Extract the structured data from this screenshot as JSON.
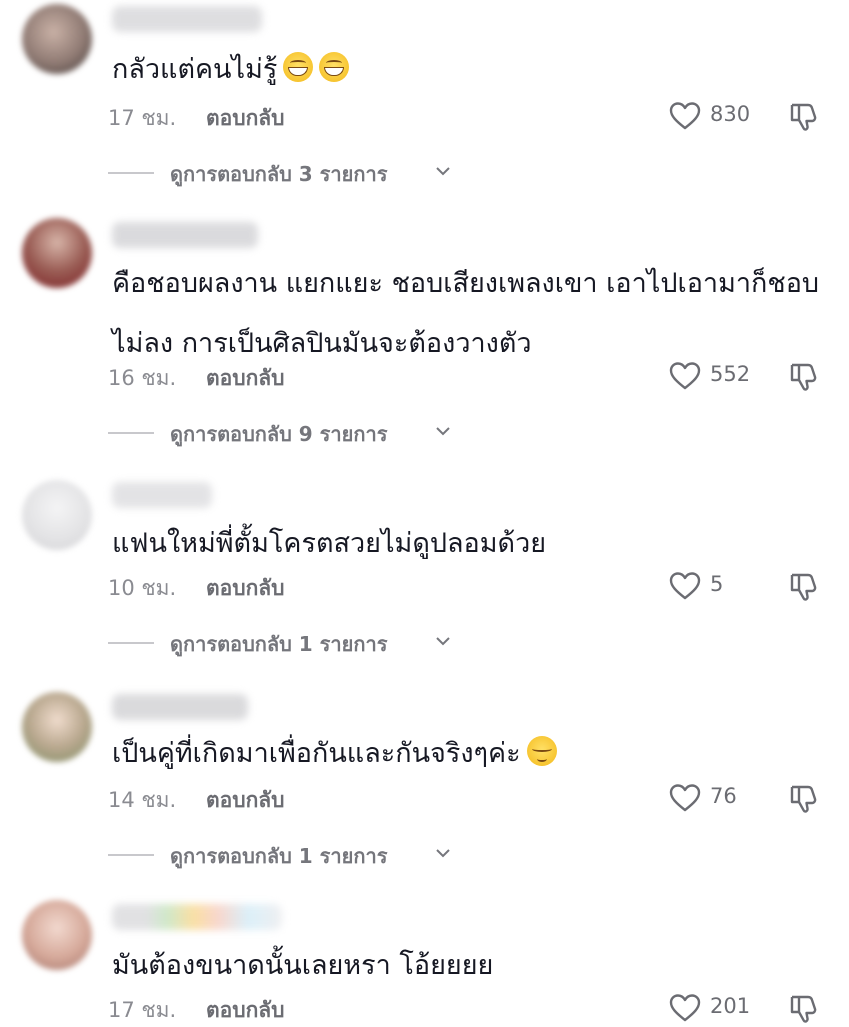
{
  "comments": [
    {
      "text": "กลัวแต่คนไม่รู้",
      "emoji": [
        "grin",
        "grin"
      ],
      "time": "17 ชม.",
      "reply_label": "ตอบกลับ",
      "likes": "830",
      "replies_label": "ดูการตอบกลับ 3 รายการ"
    },
    {
      "text": "คือชอบผลงาน แยกแยะ ชอบเสียงเพลงเขา เอาไปเอามาก็ชอบ\nไม่ลง การเป็นศิลปินมันจะต้องวางตัว",
      "emoji": [],
      "time": "16 ชม.",
      "reply_label": "ตอบกลับ",
      "likes": "552",
      "replies_label": "ดูการตอบกลับ 9 รายการ"
    },
    {
      "text": "แฟนใหม่พี่ตั้มโครตสวยไม่ดูปลอมด้วย",
      "emoji": [],
      "time": "10 ชม.",
      "reply_label": "ตอบกลับ",
      "likes": "5",
      "replies_label": "ดูการตอบกลับ 1 รายการ"
    },
    {
      "text": "เป็นคู่ที่เกิดมาเพื่อกันและกันจริงๆค่ะ",
      "emoji": [
        "relieved"
      ],
      "time": "14 ชม.",
      "reply_label": "ตอบกลับ",
      "likes": "76",
      "replies_label": "ดูการตอบกลับ 1 รายการ"
    },
    {
      "text": "มันต้องขนาดนั้นเลยหรา โอ้ยยยย",
      "emoji": [],
      "time": "17 ชม.",
      "reply_label": "ตอบกลับ",
      "likes": "201",
      "replies_label": ""
    }
  ],
  "colors": {
    "text": "#161823",
    "meta": "#8a8b91",
    "icon": "#6b6c72"
  },
  "icons": {
    "like": "heart-icon",
    "dislike": "thumbs-down-icon",
    "expand": "chevron-down-icon"
  }
}
